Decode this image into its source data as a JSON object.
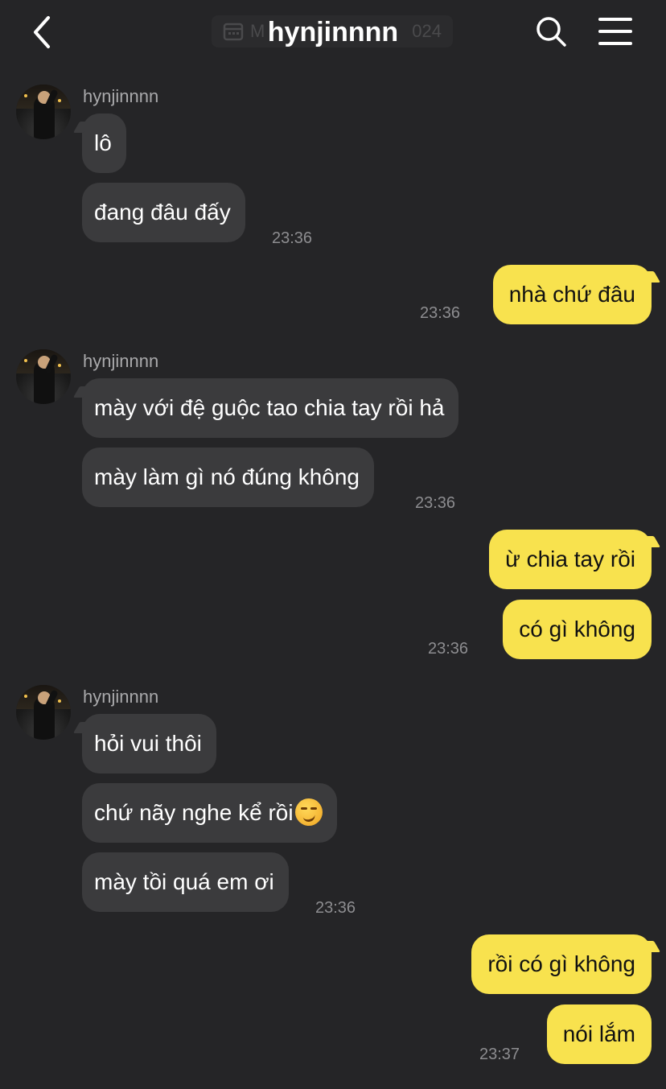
{
  "header": {
    "title": "hynjinnnn",
    "date_left": "M",
    "date_right": "024"
  },
  "groups": [
    {
      "sender": "hynjinnnn",
      "messages": [
        "lô",
        "đang đâu đấy"
      ],
      "time": "23:36"
    },
    {
      "outgoing": [
        "nhà chứ đâu"
      ],
      "time": "23:36"
    },
    {
      "sender": "hynjinnnn",
      "messages": [
        "mày với đệ guộc tao chia tay rồi hả",
        "mày làm gì nó đúng không"
      ],
      "time": "23:36"
    },
    {
      "outgoing": [
        "ừ chia tay rồi",
        "có gì không"
      ],
      "time": "23:36"
    },
    {
      "sender": "hynjinnnn",
      "messages": [
        "hỏi vui thôi",
        "chứ nãy nghe kể rồi",
        "mày tồi quá em ơi"
      ],
      "emoji": "smirking-face",
      "time": "23:36"
    },
    {
      "outgoing": [
        "rồi có gì không",
        "nói lắm"
      ],
      "time": "23:37"
    }
  ],
  "colors": {
    "background": "#252527",
    "incoming_bubble": "#3b3b3d",
    "outgoing_bubble": "#f8e24e"
  }
}
